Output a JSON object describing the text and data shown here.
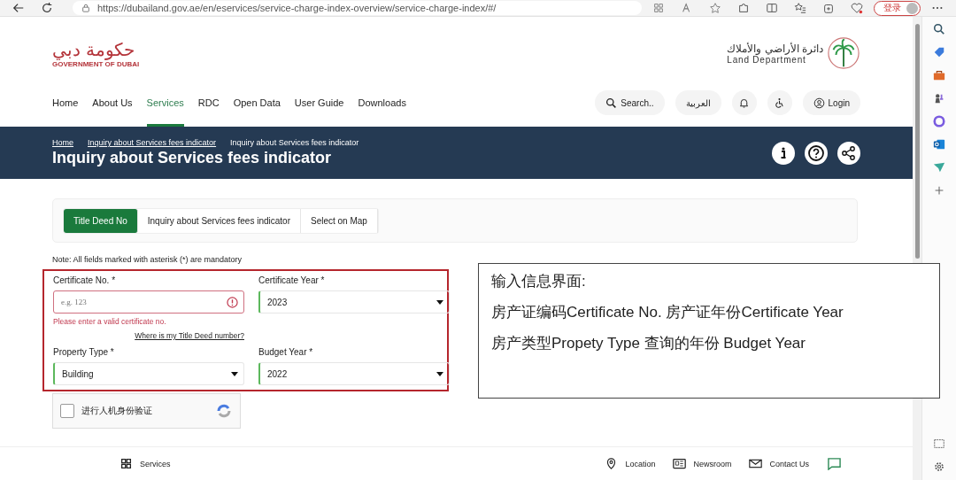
{
  "browser": {
    "url": "https://dubailand.gov.ae/en/eservices/service-charge-index-overview/service-charge-index/#/",
    "account_label": "登录"
  },
  "header": {
    "left_logo": {
      "arabic": "حكومة دبي",
      "english": "GOVERNMENT OF DUBAI"
    },
    "right_logo": {
      "arabic": "دائرة الأراضي والأملاك",
      "english": "Land Department"
    }
  },
  "nav": [
    {
      "label": "Home",
      "selected": false
    },
    {
      "label": "About Us",
      "selected": false
    },
    {
      "label": "Services",
      "selected": true
    },
    {
      "label": "RDC",
      "selected": false
    },
    {
      "label": "Open Data",
      "selected": false
    },
    {
      "label": "User Guide",
      "selected": false
    },
    {
      "label": "Downloads",
      "selected": false
    }
  ],
  "nav_actions": {
    "search_placeholder": "Search..",
    "language": "العربية",
    "login": "Login"
  },
  "banner": {
    "breadcrumbs": [
      "Home",
      "Inquiry about Services fees indicator",
      "Inquiry about Services fees indicator"
    ],
    "title": "Inquiry about Services fees indicator"
  },
  "tabs": [
    {
      "label": "Title Deed No",
      "selected": true
    },
    {
      "label": "Inquiry about Services fees indicator",
      "selected": false
    },
    {
      "label": "Select on Map",
      "selected": false
    }
  ],
  "note": "Note: All fields marked with asterisk (*) are mandatory",
  "fields": [
    {
      "kind": "input",
      "label": "Certificate No. *",
      "placeholder": "e.g. 123",
      "error": "Please enter a valid certificate no.",
      "help_link": "Where is my Title Deed number?"
    },
    {
      "kind": "select",
      "label": "Certificate Year *",
      "value": "2023"
    },
    {
      "kind": "select",
      "label": "Property Type *",
      "value": "Building"
    },
    {
      "kind": "select",
      "label": "Budget Year *",
      "value": "2022"
    }
  ],
  "captcha": {
    "label": "进行人机身份验证",
    "checked": false
  },
  "footer": {
    "services": "Services",
    "links": [
      "Location",
      "Newsroom",
      "Contact Us"
    ]
  },
  "annotation": {
    "lines": [
      "输入信息界面:",
      "房产证编码Certificate No.  房产证年份Certificate Year",
      "房产类型Propety Type 查询的年份 Budget Year"
    ]
  }
}
